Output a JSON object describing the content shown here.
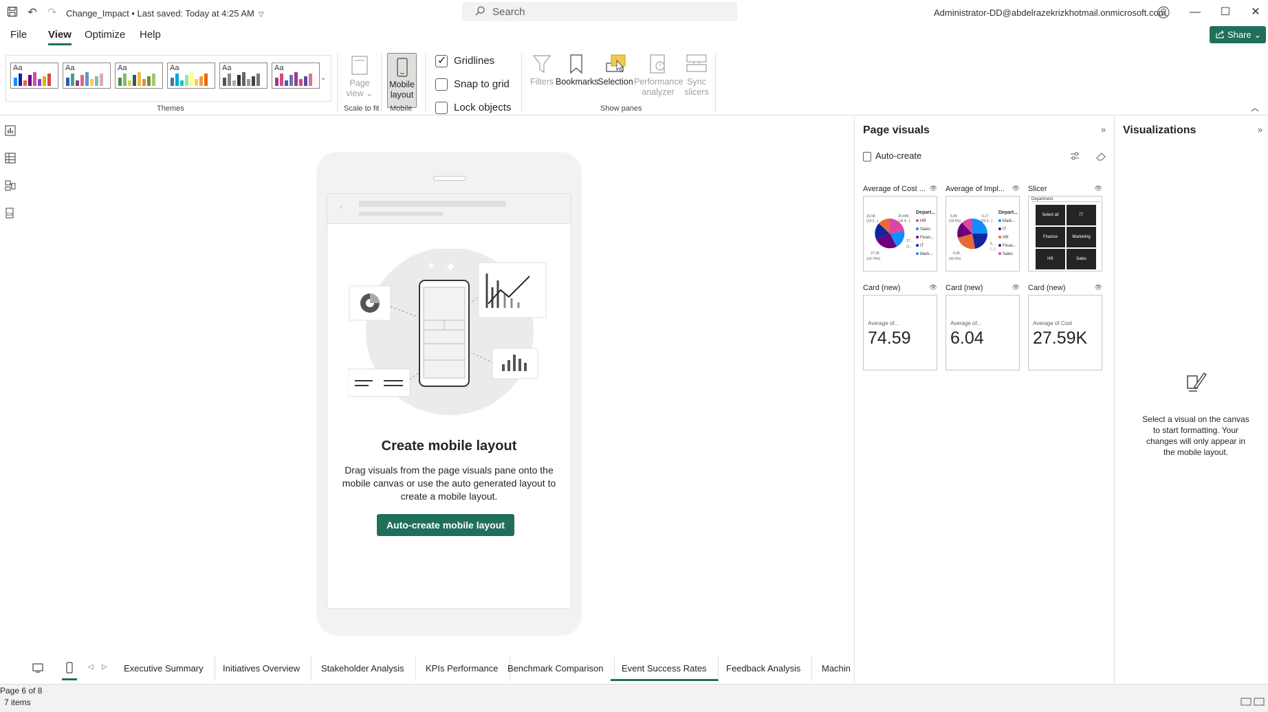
{
  "titlebar": {
    "doc_title": "Change_Impact • Last saved: Today at 4:25 AM",
    "search_placeholder": "Search",
    "account": "Administrator-DD@abdelrazekrizkhotmail.onmicrosoft.com",
    "minimize": "—",
    "maximize": "☐",
    "close": "✕"
  },
  "menu": {
    "tabs": [
      "File",
      "View",
      "Optimize",
      "Help"
    ],
    "active": "View",
    "share_label": "Share"
  },
  "ribbon": {
    "themes_label": "Themes",
    "theme_aa": "Aa",
    "page_view_label": "Page view",
    "scale_to_fit_label": "Scale to fit",
    "mobile_layout_label": "Mobile layout",
    "mobile_group_label": "Mobile",
    "gridlines_label": "Gridlines",
    "snap_label": "Snap to grid",
    "lock_label": "Lock objects",
    "gridlines_checked": true,
    "snap_checked": false,
    "lock_checked": false,
    "filters_label": "Filters",
    "bookmarks_label": "Bookmarks",
    "selection_label": "Selection",
    "performance_label": "Performance analyzer",
    "sync_label": "Sync slicers",
    "show_panes_label": "Show panes",
    "theme_palettes": [
      [
        "#118DFF",
        "#12239E",
        "#E66C37",
        "#6B007B",
        "#E044A7",
        "#744EC2",
        "#D9B300",
        "#D64550"
      ],
      [
        "#3257A8",
        "#37A794",
        "#8B3D88",
        "#DD6B7F",
        "#6B91C9",
        "#F5C869",
        "#77C4A8",
        "#DEA6CF"
      ],
      [
        "#4B8A55",
        "#8DB75E",
        "#C6D85D",
        "#2F5F47",
        "#F2B84B",
        "#E38D4C",
        "#6F8E3C",
        "#A3C86F"
      ],
      [
        "#2C7BB6",
        "#00A6CA",
        "#00CCBC",
        "#90EB9D",
        "#FFFF8C",
        "#F9D057",
        "#F29E2E",
        "#E76818"
      ],
      [
        "#555555",
        "#888888",
        "#AAAAAA",
        "#333333",
        "#666666",
        "#999999",
        "#444444",
        "#777777"
      ],
      [
        "#A5378C",
        "#D74A7B",
        "#3F5FA8",
        "#6673B5",
        "#9C3F7D",
        "#C64D8F",
        "#5B4C9C",
        "#E3708E"
      ]
    ]
  },
  "canvas": {
    "title": "Create mobile layout",
    "description": "Drag visuals from the page visuals pane onto the mobile canvas or use the auto generated layout to create a mobile layout.",
    "button_label": "Auto-create mobile layout"
  },
  "pages": {
    "tabs": [
      "Executive Summary",
      "Initiatives Overview",
      "Stakeholder Analysis",
      "KPIs Performance",
      "Benchmark Comparison",
      "Event Success Rates",
      "Feedback Analysis",
      "Machin"
    ],
    "active": "Event Success Rates"
  },
  "status": {
    "page": "Page 6 of 8",
    "items": "7 items"
  },
  "page_visuals": {
    "title": "Page visuals",
    "autocreate_label": "Auto-create",
    "visuals": [
      {
        "label": "Average of Cost ...",
        "type": "pie"
      },
      {
        "label": "Average of Impl...",
        "type": "pie"
      },
      {
        "label": "Slicer",
        "type": "slicer"
      },
      {
        "label": "Card (new)",
        "type": "card",
        "small": "Average of...",
        "value": "74.59"
      },
      {
        "label": "Card (new)",
        "type": "card",
        "small": "Average of...",
        "value": "6.04"
      },
      {
        "label": "Card (new)",
        "type": "card",
        "small": "Average of Cost",
        "value": "27.59K"
      }
    ],
    "pie1": {
      "legend_title": "Depart...",
      "legend": [
        "HR",
        "Sales",
        "Finan...",
        "IT",
        "Mark..."
      ],
      "labels": [
        "26.5K",
        "(19.2...)",
        "25.44K",
        "(18.4...)",
        "27...",
        "(1...",
        "27.2K",
        "(19.79%)"
      ]
    },
    "pie2": {
      "legend_title": "Depart...",
      "legend": [
        "Mark...",
        "IT",
        "HR",
        "Finan...",
        "Sales"
      ],
      "labels": [
        "5.89",
        "(19.5%)",
        "6.17",
        "(20.4...)",
        "6...",
        "(...)",
        "6.05",
        "(20.0%)"
      ]
    },
    "slicer": {
      "header": "Department",
      "options": [
        "Select all",
        "IT",
        "Finance",
        "Marketing",
        "HR",
        "Sales"
      ]
    },
    "legend_colors": [
      "#118DFF",
      "#E044A7",
      "#6B007B",
      "#12239E",
      "#E66C37"
    ]
  },
  "visualizations": {
    "title": "Visualizations",
    "message": "Select a visual on the canvas to start formatting. Your changes will only appear in the mobile layout."
  }
}
